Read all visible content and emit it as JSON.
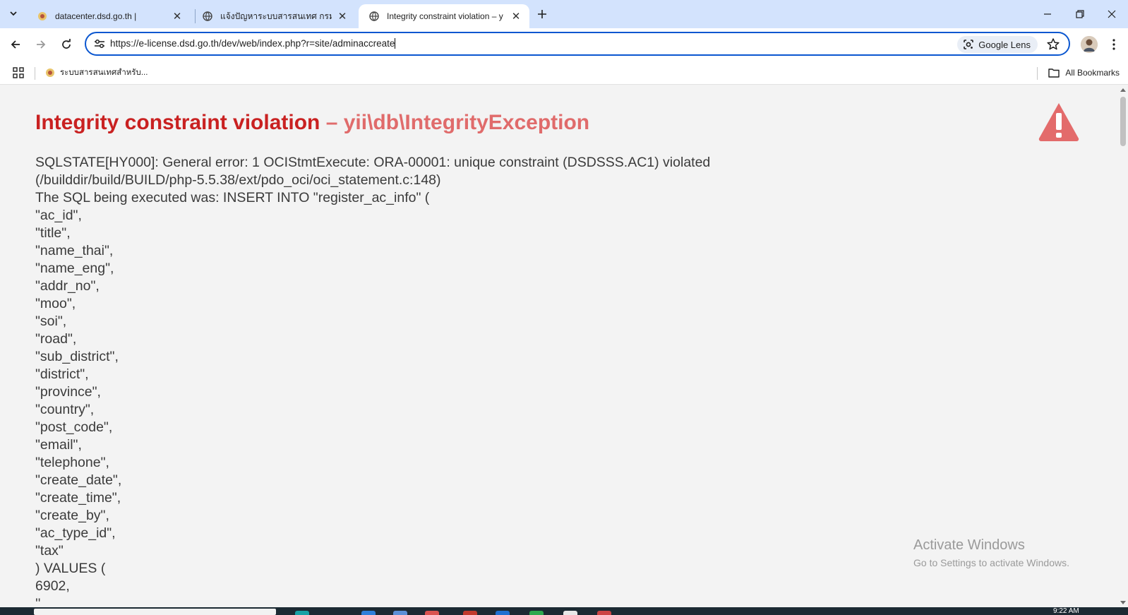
{
  "browser": {
    "tabs": [
      {
        "title": "datacenter.dsd.go.th |",
        "active": false
      },
      {
        "title": "แจ้งปัญหาระบบสารสนเทศ กรมพัฒนา",
        "active": false
      },
      {
        "title": "Integrity constraint violation – y",
        "active": true
      }
    ],
    "url": "https://e-license.dsd.go.th/dev/web/index.php?r=site/adminaccreate",
    "google_lens_label": "Google Lens",
    "bookmarks": [
      {
        "label": "ระบบสารสนเทศสำหรับ..."
      }
    ],
    "all_bookmarks_label": "All Bookmarks"
  },
  "error": {
    "title": "Integrity constraint violation",
    "separator": " – ",
    "exception_class": "yii\\db\\IntegrityException",
    "message_lines": [
      "SQLSTATE[HY000]: General error: 1 OCIStmtExecute: ORA-00001: unique constraint (DSDSSS.AC1) violated",
      "(/builddir/build/BUILD/php-5.5.38/ext/pdo_oci/oci_statement.c:148)",
      "The SQL being executed was: INSERT INTO \"register_ac_info\" (",
      "\"ac_id\",",
      "\"title\",",
      "\"name_thai\",",
      "\"name_eng\",",
      "\"addr_no\",",
      "\"moo\",",
      "\"soi\",",
      "\"road\",",
      "\"sub_district\",",
      "\"district\",",
      "\"province\",",
      "\"country\",",
      "\"post_code\",",
      "\"email\",",
      "\"telephone\",",
      "\"create_date\",",
      "\"create_time\",",
      "\"create_by\",",
      "\"ac_type_id\",",
      "\"tax\"",
      ") VALUES (",
      "6902,",
      "''"
    ],
    "title_color": "#c92121",
    "class_color": "#e06b6b"
  },
  "watermark": {
    "line1": "Activate Windows",
    "line2": "Go to Settings to activate Windows."
  },
  "taskbar": {
    "clock": "9:22 AM"
  }
}
